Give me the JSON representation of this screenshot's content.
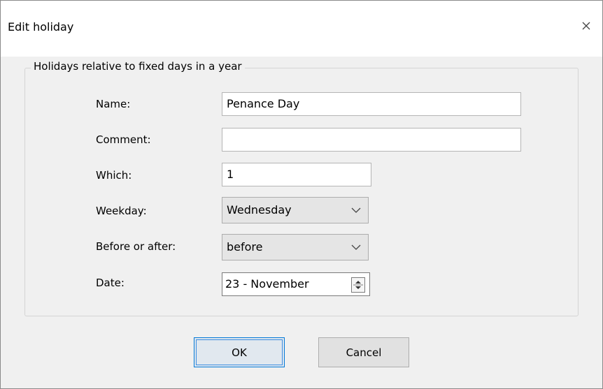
{
  "dialog": {
    "title": "Edit holiday"
  },
  "group": {
    "legend": "Holidays relative to fixed days in a year",
    "fields": {
      "name": {
        "label": "Name:",
        "value": "Penance Day"
      },
      "comment": {
        "label": "Comment:",
        "value": ""
      },
      "which": {
        "label": "Which:",
        "value": "1"
      },
      "weekday": {
        "label": "Weekday:",
        "value": "Wednesday"
      },
      "before_after": {
        "label": "Before or after:",
        "value": "before"
      },
      "date": {
        "label": "Date:",
        "value": "23 - November"
      }
    }
  },
  "buttons": {
    "ok": "OK",
    "cancel": "Cancel"
  },
  "icons": {
    "close": "close-icon",
    "dropdown": "chevron-down-icon",
    "spinner": "spin-arrows-icon"
  },
  "colors": {
    "accent": "#0078d7",
    "background": "#f0f0f0"
  }
}
